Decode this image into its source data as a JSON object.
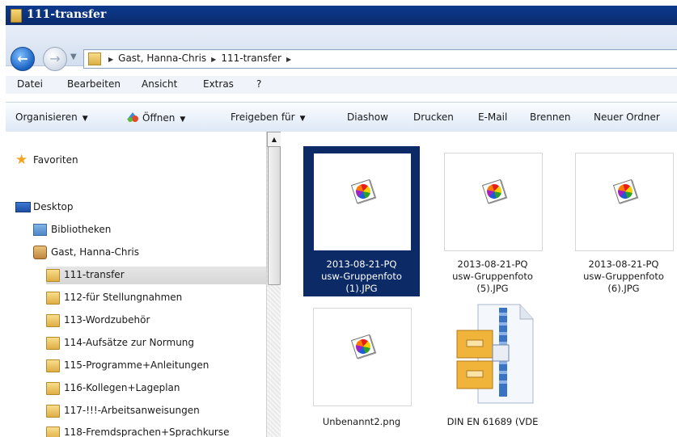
{
  "window": {
    "title": "111-transfer"
  },
  "address": {
    "crumbs": [
      "Gast, Hanna-Chris",
      "111-transfer"
    ]
  },
  "menu": [
    "Datei",
    "Bearbeiten",
    "Ansicht",
    "Extras",
    "?"
  ],
  "toolbar": {
    "organize": "Organisieren",
    "open": "Öffnen",
    "share": "Freigeben für",
    "slideshow": "Diashow",
    "print": "Drucken",
    "email": "E-Mail",
    "burn": "Brennen",
    "new_folder": "Neuer Ordner"
  },
  "tree": {
    "favorites": "Favoriten",
    "desktop": "Desktop",
    "libraries": "Bibliotheken",
    "user": "Gast, Hanna-Chris",
    "folders": [
      "111-transfer",
      "112-für Stellungnahmen",
      "113-Wordzubehör",
      "114-Aufsätze zur Normung",
      "115-Programme+Anleitungen",
      "116-Kollegen+Lageplan",
      "117-!!!-Arbeitsanweisungen",
      "118-Fremdsprachen+Sprachkurse"
    ]
  },
  "files": [
    {
      "line1": "2013-08-21-PQ",
      "line2": "usw-Gruppenfoto",
      "line3": "(1).JPG"
    },
    {
      "line1": "2013-08-21-PQ",
      "line2": "usw-Gruppenfoto",
      "line3": "(5).JPG"
    },
    {
      "line1": "2013-08-21-PQ",
      "line2": "usw-Gruppenfoto",
      "line3": "(6).JPG"
    },
    {
      "line1": "Unbenannt2.png"
    },
    {
      "line1": "DIN EN 61689 (VDE"
    }
  ],
  "icons": {
    "back": "back-arrow-icon",
    "forward": "forward-arrow-icon",
    "folder": "folder-icon",
    "favorites": "star-icon",
    "image": "image-file-icon",
    "zip": "zip-archive-icon"
  }
}
